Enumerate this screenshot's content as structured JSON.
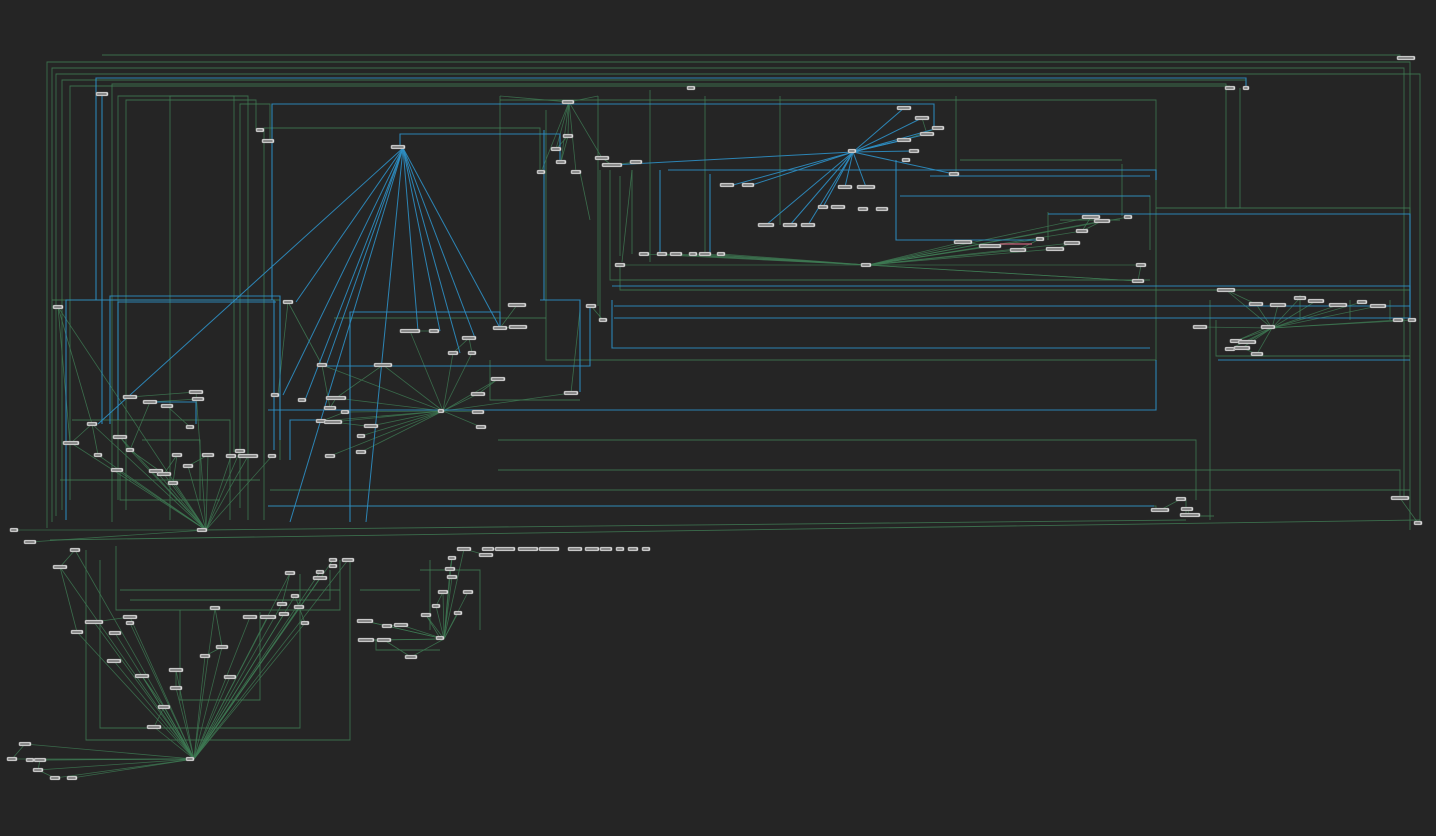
{
  "canvas": {
    "background": "#252525"
  },
  "colors": {
    "edge_green": "#3f7a54",
    "edge_green_dim": "#2f5f40",
    "edge_blue": "#2e8fc4",
    "edge_red": "#c8607a",
    "node_fill": "#f4f4f4",
    "node_border": "#9a9a9a"
  },
  "note": ""
}
